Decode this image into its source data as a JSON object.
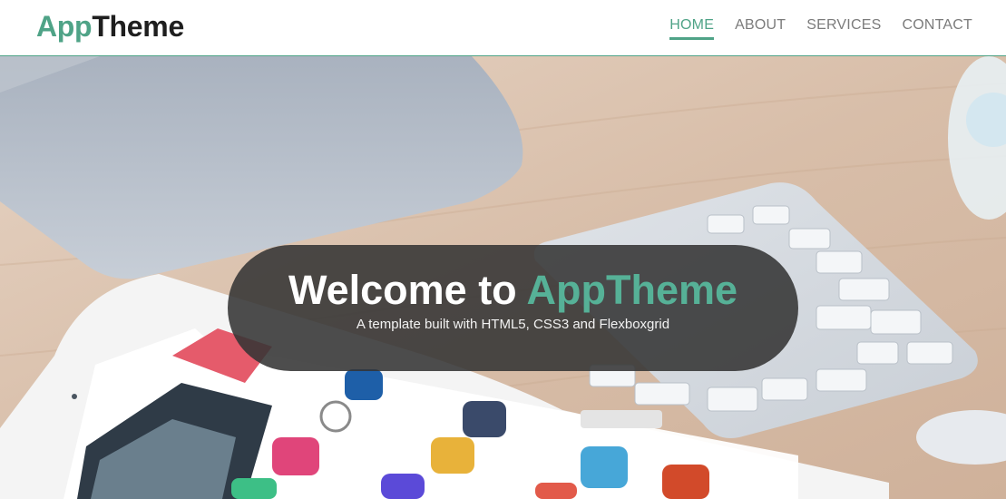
{
  "header": {
    "logo_part1": "App",
    "logo_part2": "Theme",
    "nav": {
      "home": "HOME",
      "about": "ABOUT",
      "services": "SERVICES",
      "contact": "CONTACT"
    },
    "active_item": "HOME"
  },
  "hero": {
    "title_part1": "Welcome to ",
    "title_part2": "AppTheme",
    "subtitle": "A template built with HTML5, CSS3 and Flexboxgrid",
    "background": "desk-with-monitor-keyboard-tablet-photo"
  },
  "colors": {
    "accent": "#4fa387",
    "text_dark": "#1e1e1e",
    "nav_text": "#7b7b7b",
    "banner_bg": "#343434"
  }
}
